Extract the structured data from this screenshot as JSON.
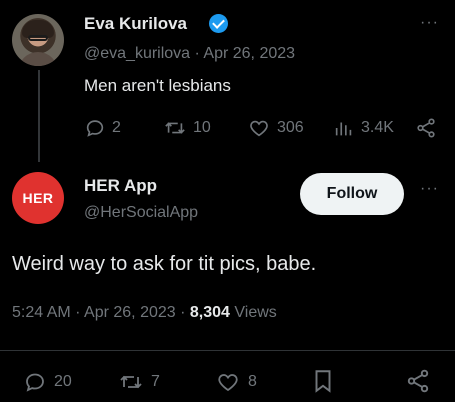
{
  "tweet1": {
    "name": "Eva Kurilova",
    "handle_date": "@eva_kurilova · Apr 26, 2023",
    "text": "Men aren't lesbians",
    "replies": "2",
    "retweets": "10",
    "likes": "306",
    "views": "3.4K",
    "more": "···"
  },
  "tweet2": {
    "name": "HER App",
    "handle": "@HerSocialApp",
    "avatar_text": "HER",
    "follow_label": "Follow",
    "more": "···",
    "text": "Weird way to ask for tit pics, babe.",
    "time_date": "5:24 AM · Apr 26, 2023 · ",
    "views_count": "8,304",
    "views_label": " Views",
    "replies": "20",
    "retweets": "7",
    "likes": "8"
  },
  "colors": {
    "background": "#000000",
    "text": "#e7e9ea",
    "muted": "#71767b",
    "verified": "#1d9bf0",
    "her_brand": "#e0322f"
  },
  "icons": [
    "verified-badge-icon",
    "reply-icon",
    "retweet-icon",
    "like-icon",
    "views-icon",
    "share-icon",
    "bookmark-icon",
    "more-icon"
  ]
}
